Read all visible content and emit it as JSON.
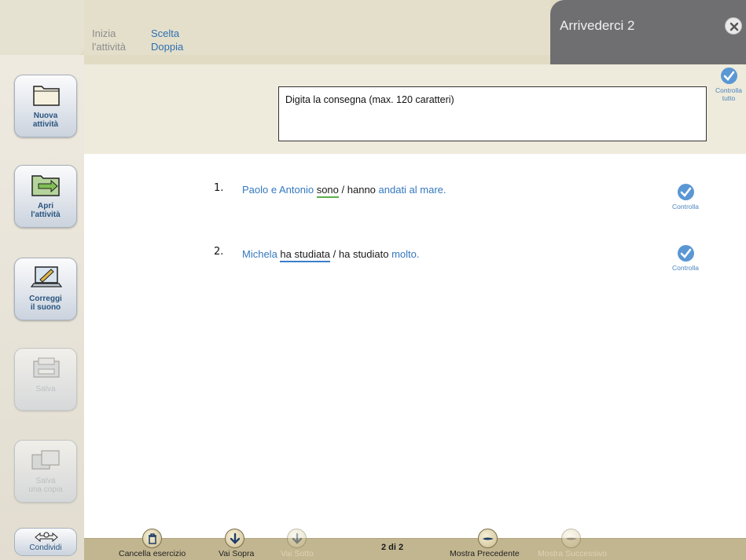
{
  "header": {
    "tab1_line1": "Inizia",
    "tab1_line2": "l'attività",
    "tab2_line1": "Scelta",
    "tab2_line2": "Doppia",
    "title": "Arrivederci 2",
    "close_icon": "close-icon"
  },
  "sidebar": {
    "new_activity": "Nuova\nattività",
    "open_activity": "Apri\nl'attività",
    "correct_sound": "Correggi\nil suono",
    "save": "Salva",
    "save_copy": "Salva\nuna copia",
    "share": "Condividi"
  },
  "instruction": {
    "placeholder": "Digita  la consegna (max. 120 caratteri)",
    "check_all_label": "Controlla\ntutto"
  },
  "exercise": {
    "items": [
      {
        "number": "1.",
        "prefix": "Paolo e Antonio",
        "option_a": "sono",
        "separator": " / ",
        "option_b": "hanno",
        "suffix": " andati al mare.",
        "check_label": "Controlla"
      },
      {
        "number": "2.",
        "prefix": "Michela",
        "option_a": "ha studiata",
        "separator": " / ",
        "option_b": "ha studiato",
        "suffix": " molto.",
        "check_label": "Controlla"
      }
    ]
  },
  "toolbar": {
    "clear_exercise": "Cancella esercizio",
    "go_up": "Vai Sopra",
    "go_down": "Vai Sotto",
    "page": "2 di 2",
    "show_previous": "Mostra Precedente",
    "show_next": "Mostra Successivo"
  },
  "colors": {
    "accent_blue": "#3478bf",
    "header_dark": "#6f6f72",
    "toolbar": "#c2b690",
    "underline_green": "#5bb04a"
  }
}
